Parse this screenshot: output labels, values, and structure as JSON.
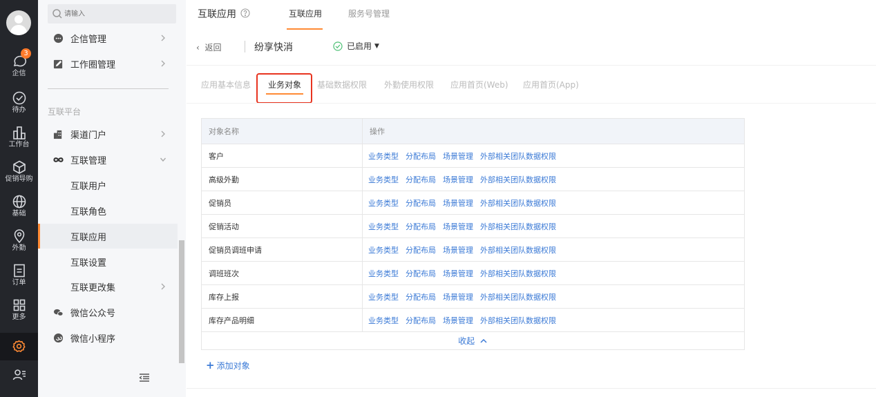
{
  "rail": {
    "items": [
      {
        "label": "企信",
        "badge": "3"
      },
      {
        "label": "待办"
      },
      {
        "label": "工作台"
      },
      {
        "label": "促销导购"
      },
      {
        "label": "基础"
      },
      {
        "label": "外勤"
      },
      {
        "label": "订单"
      },
      {
        "label": "更多"
      }
    ],
    "active_color": "#ff8a34"
  },
  "sidebar": {
    "search_placeholder": "请输入",
    "items_top": [
      {
        "label": "企信管理"
      },
      {
        "label": "工作圈管理"
      }
    ],
    "group_label": "互联平台",
    "items": [
      {
        "label": "渠道门户"
      },
      {
        "label": "互联管理"
      },
      {
        "label": "互联用户"
      },
      {
        "label": "互联角色"
      },
      {
        "label": "互联应用"
      },
      {
        "label": "互联设置"
      },
      {
        "label": "互联更改集"
      },
      {
        "label": "微信公众号"
      },
      {
        "label": "微信小程序"
      }
    ]
  },
  "header": {
    "title": "互联应用",
    "tabs": [
      {
        "label": "互联应用"
      },
      {
        "label": "服务号管理"
      }
    ],
    "active_tab": "互联应用"
  },
  "appbar": {
    "back_label": "返回",
    "app_name": "纷享快消",
    "status": "已启用"
  },
  "subtabs": [
    {
      "label": "应用基本信息"
    },
    {
      "label": "业务对象"
    },
    {
      "label": "基础数据权限"
    },
    {
      "label": "外勤使用权限"
    },
    {
      "label": "应用首页(Web)"
    },
    {
      "label": "应用首页(App)"
    }
  ],
  "table": {
    "columns": [
      "对象名称",
      "操作"
    ],
    "actions": [
      "业务类型",
      "分配布局",
      "场景管理",
      "外部相关团队数据权限"
    ],
    "rows": [
      "客户",
      "高级外勤",
      "促销员",
      "促销活动",
      "促销员调班申请",
      "调班班次",
      "库存上报",
      "库存产品明细"
    ],
    "collapse_label": "收起"
  },
  "add_object_label": "添加对象",
  "colors": {
    "accent": "#ff8a34",
    "link": "#3b7ad6",
    "highlight": "#e8331f"
  }
}
